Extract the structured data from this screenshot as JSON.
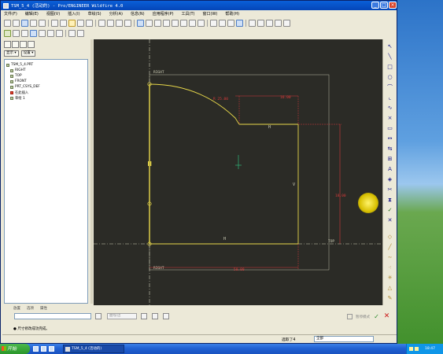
{
  "window": {
    "title": "TSM_5_4 (活动的) - Pro/ENGINEER Wildfire 4.0",
    "controls": [
      "_",
      "□",
      "×"
    ]
  },
  "menu": [
    "文件(F)",
    "编辑(E)",
    "视图(V)",
    "插入(I)",
    "草绘(S)",
    "分析(A)",
    "信息(N)",
    "应用程序(P)",
    "工具(T)",
    "窗口(W)",
    "帮助(H)"
  ],
  "left_panel": {
    "show_label": "显示 ▾",
    "settings_label": "设置 ▾",
    "tree": [
      {
        "label": "TSM_5_4.PRT",
        "level": 0,
        "icon": "part-icon"
      },
      {
        "label": "RIGHT",
        "level": 1,
        "icon": "datum-plane-icon"
      },
      {
        "label": "TOP",
        "level": 1,
        "icon": "datum-plane-icon"
      },
      {
        "label": "FRONT",
        "level": 1,
        "icon": "datum-plane-icon"
      },
      {
        "label": "PRT_CSYS_DEF",
        "level": 1,
        "icon": "csys-icon"
      },
      {
        "label": "在此插入",
        "level": 1,
        "icon": "insert-here-icon"
      },
      {
        "label": "草绘 1",
        "level": 1,
        "icon": "sketch-icon"
      }
    ]
  },
  "sketch": {
    "reference_labels": [
      "RIGHT",
      "RIGHT"
    ],
    "constraint_labels": [
      "H",
      "V",
      "H",
      "TOP"
    ],
    "dimensions": [
      "R 25.00",
      "16.00",
      "18.00",
      "50.00"
    ]
  },
  "dashboard": {
    "tabs": [
      "放置",
      "选项",
      "属性"
    ],
    "type_value": "曲线/边",
    "pause_label": "暂停模式",
    "message": "● 尺寸修改成功完成。"
  },
  "status": {
    "selected": "选取了4",
    "filter": "全部"
  },
  "taskbar": {
    "start": "开始",
    "task": "TSM_5_4 (活动的)",
    "clock": "18:47"
  },
  "colors": {
    "canvas": "#2b2b26",
    "geometry": "#e8d84a",
    "dimension": "#d63a3a",
    "reference": "#cfcfb8"
  }
}
